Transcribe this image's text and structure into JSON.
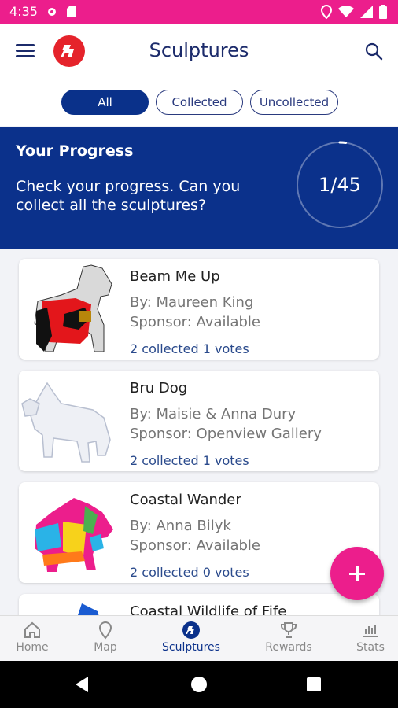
{
  "status_bar": {
    "time": "4:35"
  },
  "app_bar": {
    "title": "Sculptures"
  },
  "filters": [
    {
      "label": "All",
      "active": true
    },
    {
      "label": "Collected",
      "active": false
    },
    {
      "label": "Uncollected",
      "active": false
    }
  ],
  "progress": {
    "title": "Your Progress",
    "text": "Check your progress. Can you collect all the sculptures?",
    "count_label": "1/45",
    "collected": 1,
    "total": 45
  },
  "sculptures": [
    {
      "name": "Beam Me Up",
      "by": "By: Maureen King",
      "sponsor": "Sponsor: Available",
      "stats": "2 collected 1 votes"
    },
    {
      "name": "Bru Dog",
      "by": "By: Maisie & Anna Dury",
      "sponsor": "Sponsor: Openview Gallery",
      "stats": "2 collected 1 votes"
    },
    {
      "name": "Coastal Wander",
      "by": "By: Anna Bilyk",
      "sponsor": "Sponsor: Available",
      "stats": "2 collected 0 votes"
    },
    {
      "name": "Coastal Wildlife of Fife",
      "by": "",
      "sponsor": "",
      "stats": ""
    }
  ],
  "bottom_nav": [
    {
      "label": "Home",
      "icon": "home-icon",
      "active": false
    },
    {
      "label": "Map",
      "icon": "map-pin-icon",
      "active": false
    },
    {
      "label": "Sculptures",
      "icon": "sculpture-icon",
      "active": true
    },
    {
      "label": "Rewards",
      "icon": "trophy-icon",
      "active": false
    },
    {
      "label": "Stats",
      "icon": "stats-icon",
      "active": false
    }
  ],
  "colors": {
    "accent": "#ec1e8c",
    "primary": "#0b318b",
    "logo": "#e5232b"
  }
}
